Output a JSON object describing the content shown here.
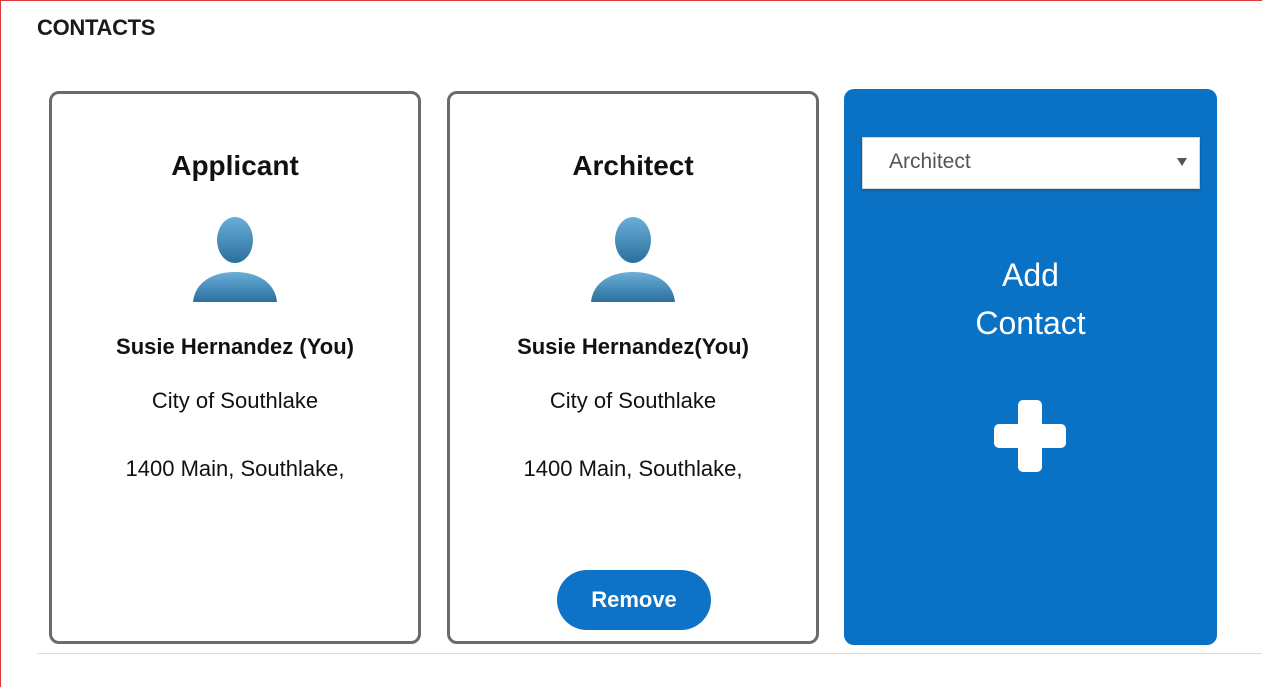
{
  "section": {
    "title": "CONTACTS"
  },
  "contacts": [
    {
      "role": "Applicant",
      "name": "Susie Hernandez (You)",
      "organization": "City of Southlake",
      "address": "1400 Main, Southlake,",
      "avatar_icon": "person-silhouette-icon"
    },
    {
      "role": "Architect",
      "name": "Susie Hernandez(You)",
      "organization": "City of Southlake",
      "address": "1400 Main, Southlake,",
      "avatar_icon": "person-silhouette-icon",
      "remove_label": "Remove"
    }
  ],
  "add_contact": {
    "selected_role": "Architect",
    "label_line1": "Add",
    "label_line2": "Contact",
    "icon": "plus-icon"
  },
  "colors": {
    "primary_blue": "#0a72c5",
    "card_border": "#6b6b6b",
    "avatar_blue": "#3f8dbe"
  }
}
